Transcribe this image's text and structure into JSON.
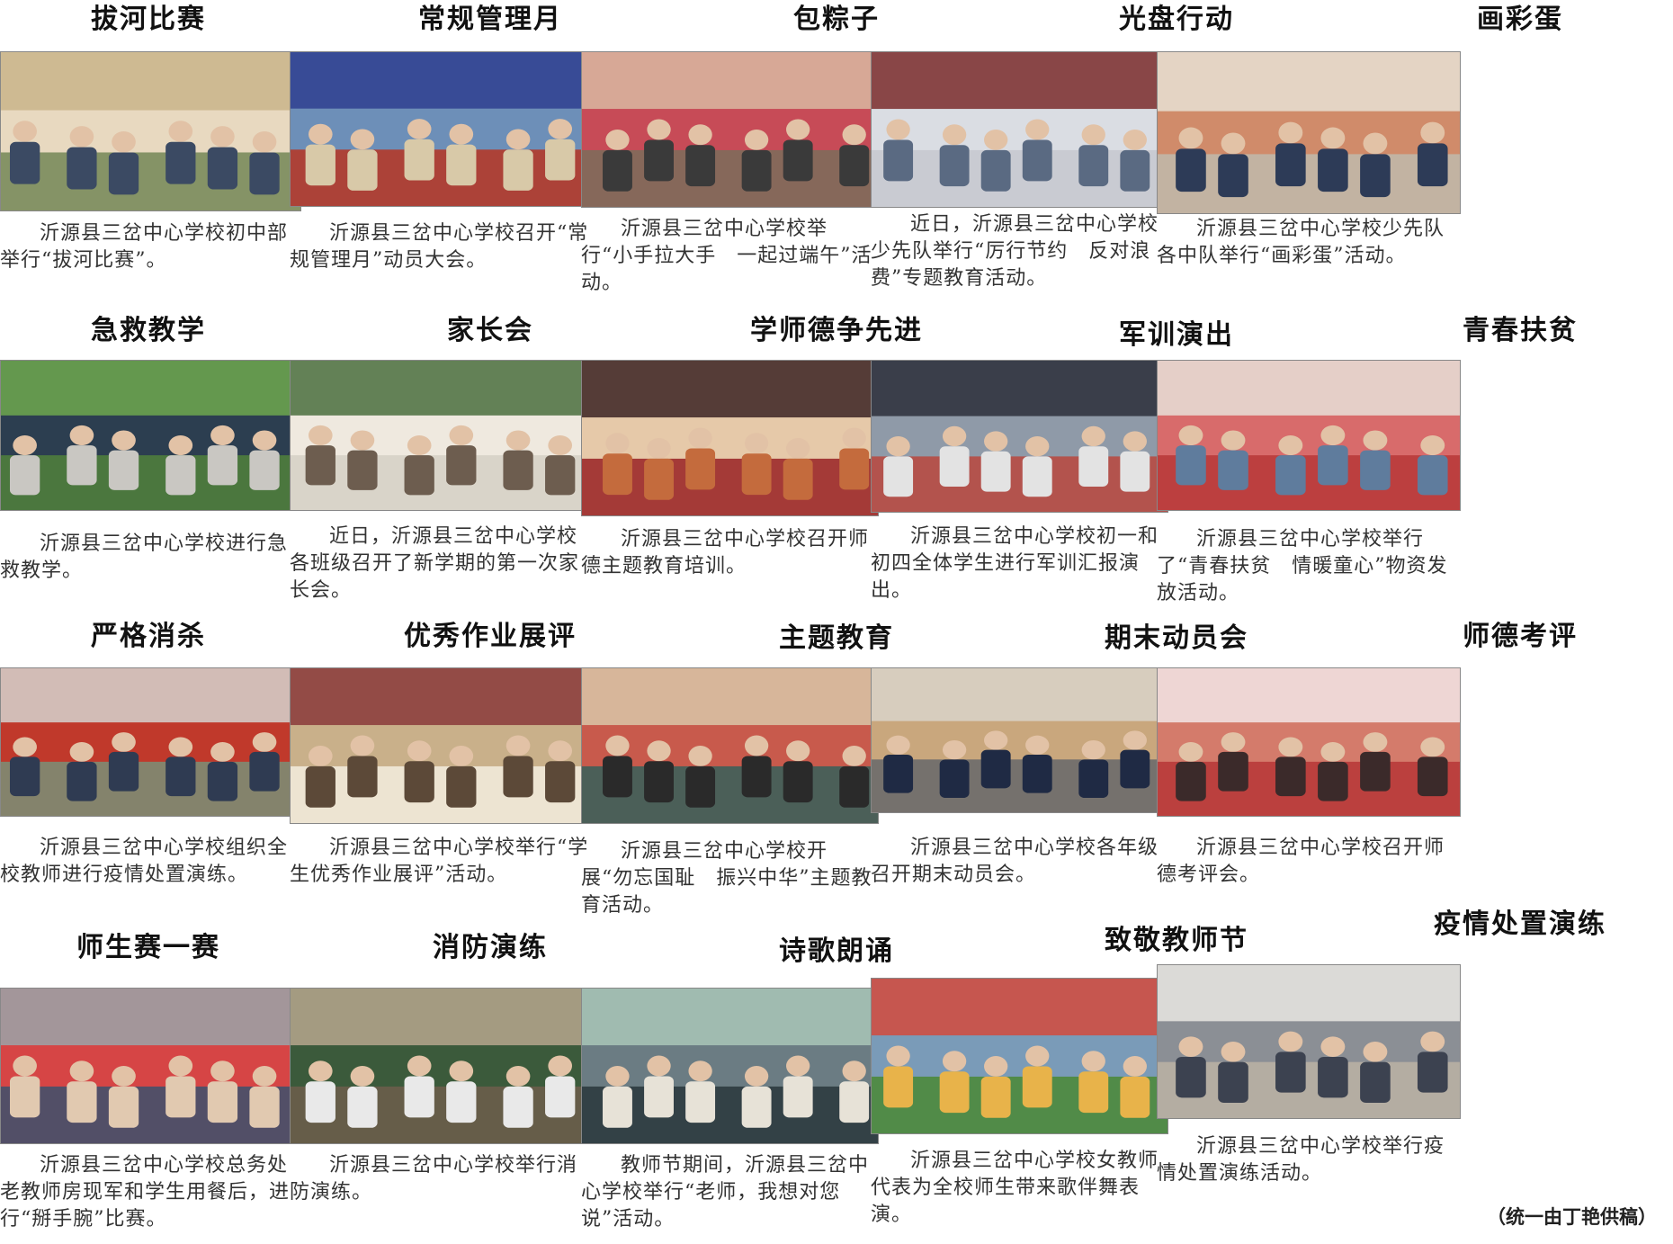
{
  "items": [
    {
      "title": "拔河比赛",
      "caption": "沂源县三岔中心学校初中部举行“拔河比赛”。",
      "icon": "tug-of-war-photo"
    },
    {
      "title": "常规管理月",
      "caption": "沂源县三岔中心学校召开“常规管理月”动员大会。",
      "icon": "assembly-photo"
    },
    {
      "title": "包粽子",
      "caption": "沂源县三岔中心学校举行“小手拉大手　一起过端午”活动。",
      "icon": "zongzi-photo"
    },
    {
      "title": "光盘行动",
      "caption": "近日，沂源县三岔中心学校少先队举行“厉行节约　反对浪费”专题教育活动。",
      "icon": "cafeteria-photo"
    },
    {
      "title": "画彩蛋",
      "caption": "沂源县三岔中心学校少先队各中队举行“画彩蛋”活动。",
      "icon": "egg-photo"
    },
    {
      "title": "急救教学",
      "caption": "沂源县三岔中心学校进行急救教学。",
      "icon": "first-aid-photo"
    },
    {
      "title": "家长会",
      "caption": "近日，沂源县三岔中心学校各班级召开了新学期的第一次家长会。",
      "icon": "classroom-photo"
    },
    {
      "title": "学师德争先进",
      "caption": "沂源县三岔中心学校召开师德主题教育培训。",
      "icon": "meeting-hall-photo"
    },
    {
      "title": "军训演出",
      "caption": "沂源县三岔中心学校初一和初四全体学生进行军训汇报演出。",
      "icon": "military-drill-photo"
    },
    {
      "title": "青春扶贫",
      "caption": "沂源县三岔中心学校举行了“青春扶贫　情暖童心”物资发放活动。",
      "icon": "donation-photo"
    },
    {
      "title": "严格消杀",
      "caption": "沂源县三岔中心学校组织全校教师进行疫情处置演练。",
      "icon": "gate-check-photo"
    },
    {
      "title": "优秀作业展评",
      "caption": "沂源县三岔中心学校举行“学生优秀作业展评”活动。",
      "icon": "homework-photo"
    },
    {
      "title": "主题教育",
      "caption": "沂源县三岔中心学校开展“勿忘国耻　振兴中华”主题教育活动。",
      "icon": "lecture-photo"
    },
    {
      "title": "期末动员会",
      "caption": "沂源县三岔中心学校各年级召开期末动员会。",
      "icon": "lineup-photo"
    },
    {
      "title": "师德考评",
      "caption": "沂源县三岔中心学校召开师德考评会。",
      "icon": "evaluation-meeting-photo"
    },
    {
      "title": "师生赛一赛",
      "caption": "沂源县三岔中心学校总务处老教师房现军和学生用餐后，进行“掰手腕”比赛。",
      "icon": "arm-wrestling-photo"
    },
    {
      "title": "消防演练",
      "caption": "沂源县三岔中心学校举行消防演练。",
      "icon": "fire-drill-photo"
    },
    {
      "title": "诗歌朗诵",
      "caption": "教师节期间，沂源县三岔中心学校举行“老师，我想对您说”活动。",
      "icon": "recitation-photo"
    },
    {
      "title": "致敬教师节",
      "caption": "沂源县三岔中心学校女教师代表为全校师生带来歌伴舞表演。",
      "icon": "dance-photo"
    },
    {
      "title": "疫情处置演练",
      "caption": "沂源县三岔中心学校举行疫情处置演练活动。",
      "icon": "ppe-drill-photo"
    }
  ],
  "credit": "（统一由丁艳供稿）"
}
